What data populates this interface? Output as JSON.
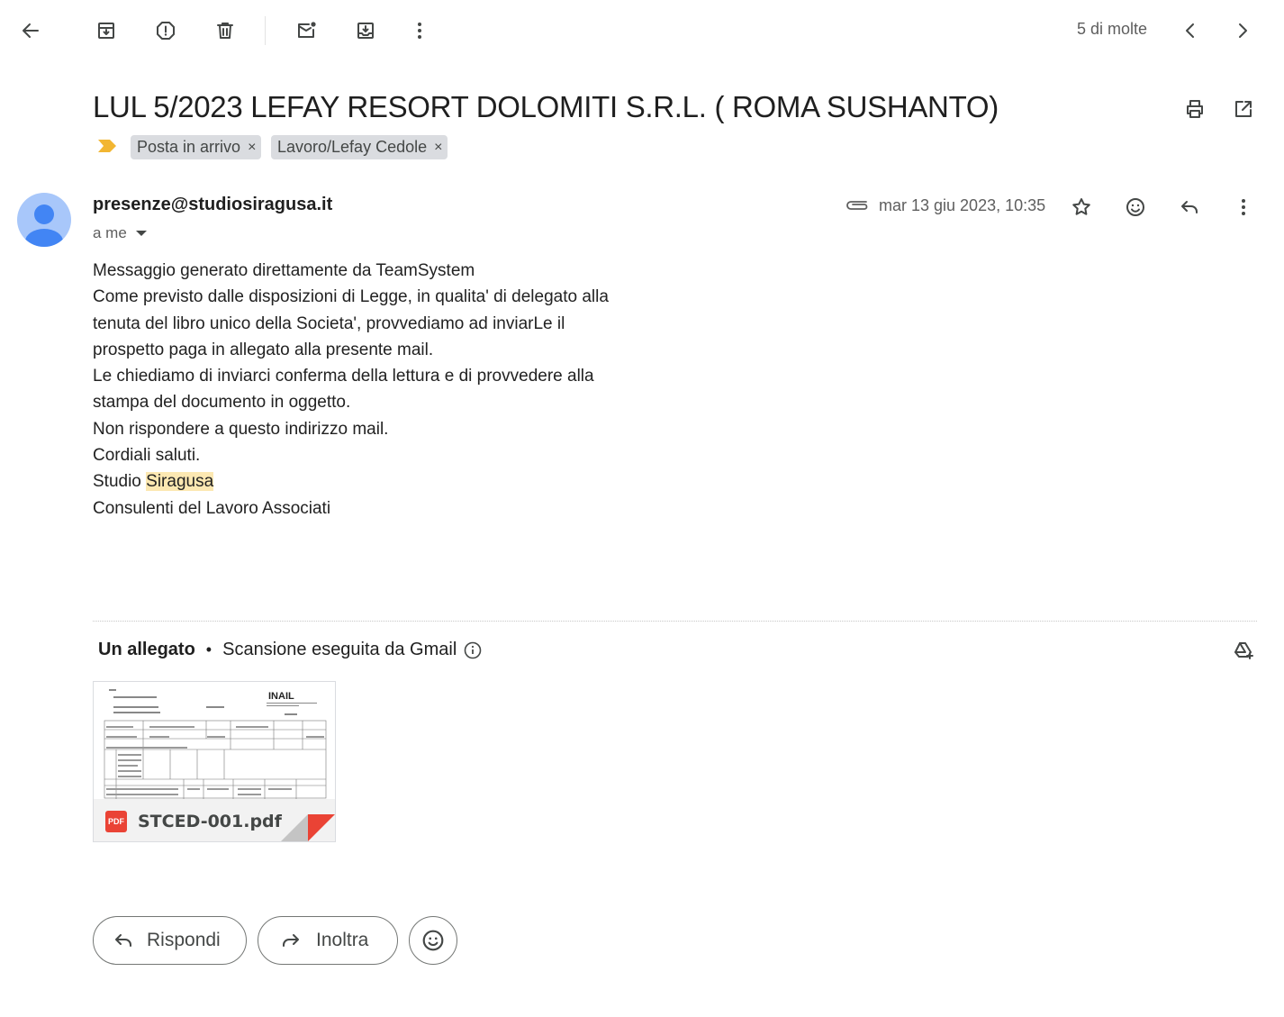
{
  "toolbar": {
    "back_icon": "arrow-left-icon",
    "archive_icon": "archive-icon",
    "spam_icon": "report-spam-icon",
    "delete_icon": "trash-icon",
    "mark_unread_icon": "mark-unread-icon",
    "move_icon": "move-to-icon",
    "more_icon": "more-vertical-icon",
    "pager_text": "5 di molte",
    "prev_icon": "chevron-left-icon",
    "next_icon": "chevron-right-icon"
  },
  "email": {
    "subject": "LUL 5/2023 LEFAY RESORT DOLOMITI S.R.L. ( ROMA SUSHANTO)",
    "labels": [
      {
        "name": "Posta in arrivo",
        "remove": "×"
      },
      {
        "name": "Lavoro/Lefay Cedole",
        "remove": "×"
      }
    ],
    "sender": "presenze@studiosiragusa.it",
    "recipient": "a me",
    "date": "mar 13 giu 2023, 10:35",
    "body_lines": [
      "Messaggio generato direttamente da TeamSystem",
      "Come previsto dalle disposizioni di Legge, in qualita' di delegato alla",
      "tenuta del libro unico della Societa', provvediamo ad inviarLe il",
      "prospetto paga in allegato alla presente mail.",
      "Le chiediamo di inviarci conferma della lettura e di provvedere alla",
      "stampa del documento in oggetto.",
      "Non rispondere a questo indirizzo mail.",
      "Cordiali saluti."
    ],
    "signature_prefix": "Studio ",
    "signature_highlight": "Siragusa",
    "signature_line2": "Consulenti del Lavoro Associati"
  },
  "attachments": {
    "title": "Un allegato",
    "separator": "•",
    "scan_text": "Scansione eseguita da Gmail",
    "file": {
      "badge": "PDF",
      "name": "STCED-001.pdf",
      "thumb_brand": "INAIL"
    }
  },
  "actions": {
    "reply_label": "Rispondi",
    "forward_label": "Inoltra"
  },
  "colors": {
    "importance": "#f2b632",
    "chip_bg": "#dadce0",
    "avatar_bg": "#a8c7fa",
    "avatar_fg": "#4285f4",
    "highlight": "#fce8b2",
    "pdf_red": "#ea4335"
  }
}
